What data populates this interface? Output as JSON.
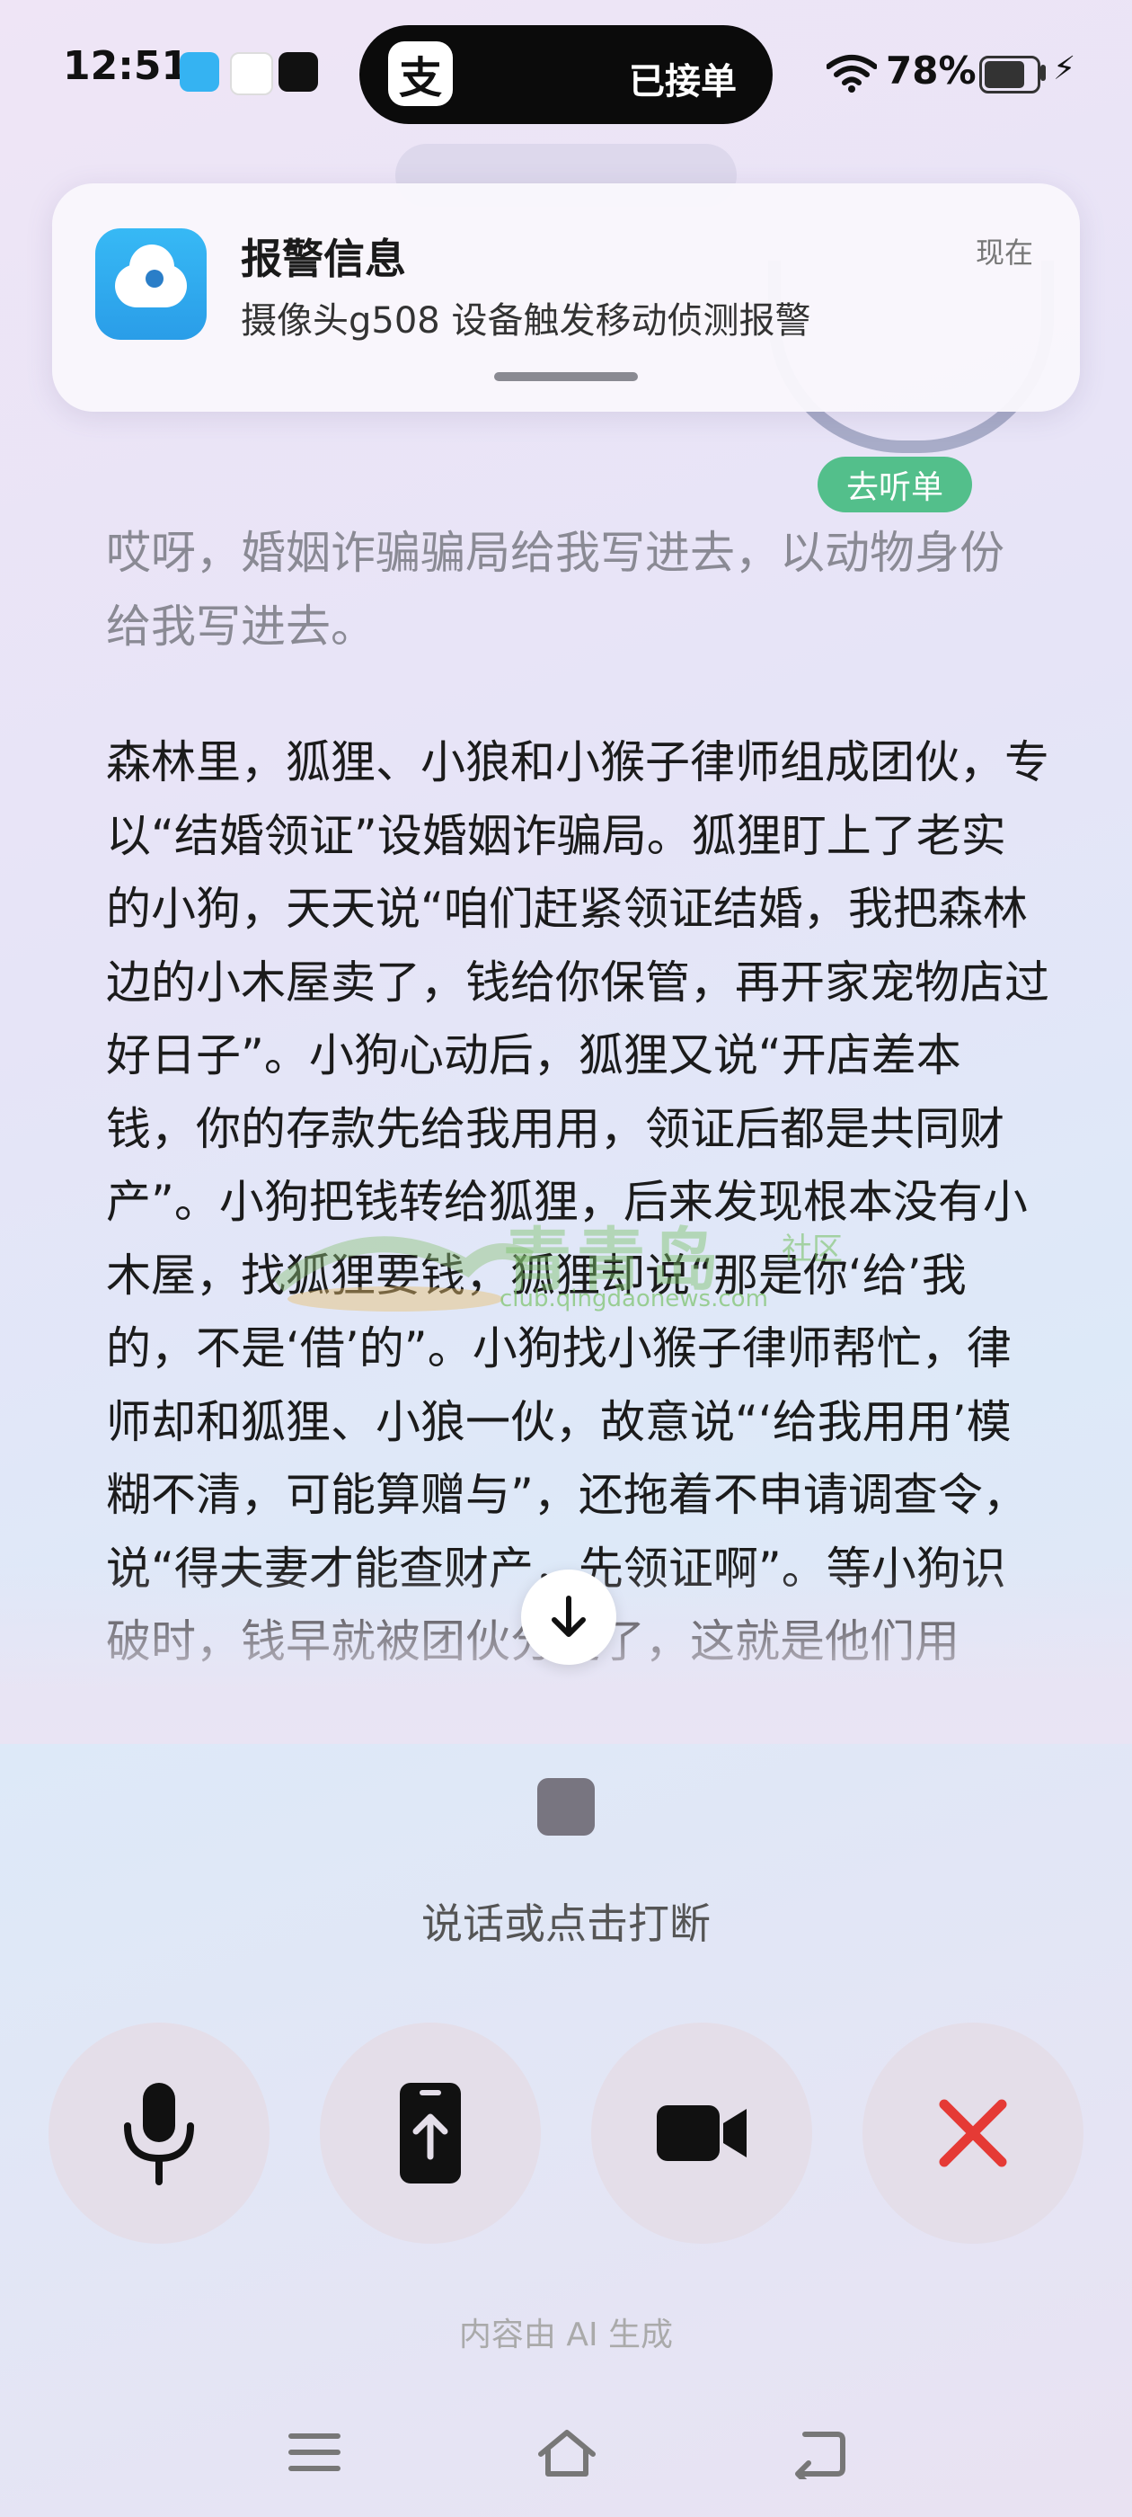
{
  "status_bar": {
    "time": "12:51",
    "live_activity_text": "已接单",
    "live_activity_app_logo": "支",
    "battery_percent": "78%",
    "battery_level": 0.78
  },
  "notification": {
    "title": "报警信息",
    "body": "摄像头g508 设备触发移动侦测报警",
    "time": "现在"
  },
  "badge": {
    "label": "去听单"
  },
  "conversation": {
    "user_prompt": "哎呀，婚姻诈骗骗局给我写进去，以动物身份给我写进去。",
    "ai_response": "森林里，狐狸、小狼和小猴子律师组成团伙，专以“结婚领证”设婚姻诈骗局。狐狸盯上了老实的小狗，天天说“咱们赶紧领证结婚，我把森林边的小木屋卖了，钱给你保管，再开家宠物店过好日子”。小狗心动后，狐狸又说“开店差本钱，你的存款先给我用用，领证后都是共同财产”。小狗把钱转给狐狸，后来发现根本没有小木屋，找狐狸要钱，狐狸却说“那是你‘给’我的，不是‘借’的”。小狗找小猴子律师帮忙，律师却和狐狸、小狼一伙，故意说“‘给我用用’模糊不清，可能算赠与”，还拖着不申请调查令，说“得夫妻才能查财产，先领证啊”。等小狗识破时，钱早就被团伙分走了，这就是他们用"
  },
  "watermark": {
    "text": "青青岛",
    "sub": "社区",
    "url": "club.qingdaonews.com"
  },
  "voice": {
    "hint": "说话或点击打断"
  },
  "controls": [
    {
      "name": "mic-button",
      "icon": "microphone-icon"
    },
    {
      "name": "share-screen-button",
      "icon": "upload-phone-icon"
    },
    {
      "name": "video-button",
      "icon": "video-camera-icon"
    },
    {
      "name": "hangup-button",
      "icon": "close-icon"
    }
  ],
  "footer": {
    "ai_note": "内容由 AI 生成"
  },
  "colors": {
    "accent_green": "#53bf8b",
    "hangup_red": "#e53a35"
  }
}
